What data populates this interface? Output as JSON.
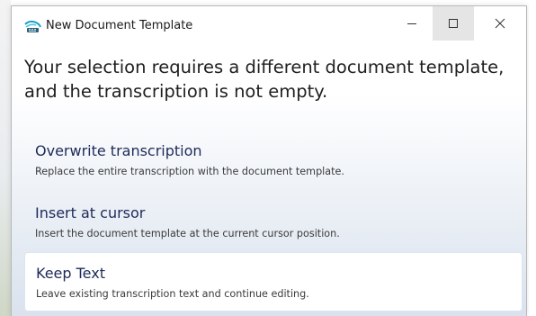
{
  "window": {
    "title": "New Document Template",
    "icon": "app-icon"
  },
  "controls": {
    "minimize_icon": "minimize-icon",
    "maximize_icon": "maximize-icon",
    "close_icon": "close-icon"
  },
  "message": {
    "line1": "Your selection requires a different document template,",
    "line2": "and the transcription is not empty."
  },
  "options": [
    {
      "title": "Overwrite transcription",
      "description": "Replace the entire transcription with the document template."
    },
    {
      "title": "Insert at cursor",
      "description": "Insert the document template at the current cursor position."
    },
    {
      "title": "Keep Text",
      "description": "Leave existing transcription text and continue editing."
    }
  ],
  "colors": {
    "title_text": "#1e2a5a",
    "desc_text": "#3a3a3a",
    "selected_bg": "#ffffff",
    "gradient_bottom": "#d9e2ee"
  }
}
